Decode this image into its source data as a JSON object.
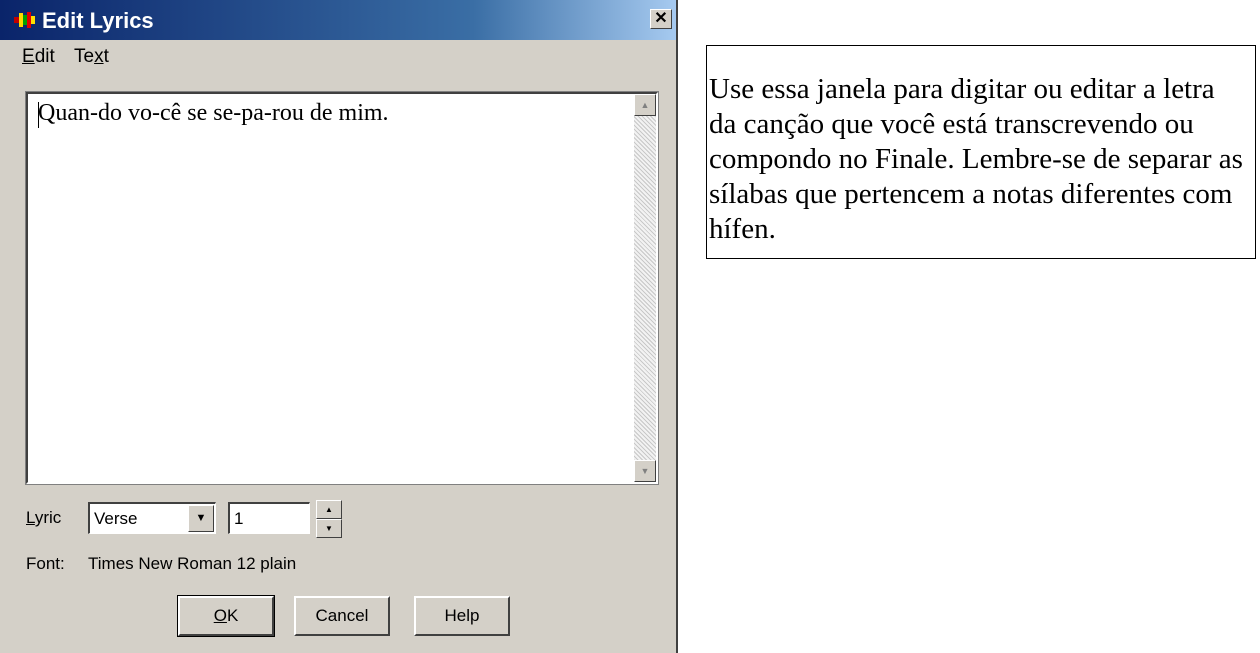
{
  "window": {
    "title": "Edit Lyrics",
    "close_glyph": "✕"
  },
  "menu": {
    "items": [
      {
        "label_pre": "",
        "accel": "E",
        "label_post": "dit"
      },
      {
        "label_pre": "Te",
        "accel": "x",
        "label_post": "t"
      }
    ]
  },
  "editor": {
    "content": "Quan-do vo-cê se se-pa-rou de mim."
  },
  "lyric": {
    "label_accel": "L",
    "label_rest": "yric",
    "type_value": "Verse",
    "number_value": "1"
  },
  "font": {
    "label": "Font:",
    "value": "Times New Roman 12 plain"
  },
  "buttons": {
    "ok_accel": "O",
    "ok_rest": "K",
    "cancel": "Cancel",
    "help": "Help"
  },
  "note": {
    "text": "Use essa janela para digitar ou editar a letra da canção que você está transcrevendo ou compondo no Finale. Lembre-se de separar as sílabas que pertencem a notas diferentes com hífen."
  },
  "colors": {
    "titlebar_start": "#0a246a",
    "titlebar_end": "#a6caf0",
    "dialog_face": "#d4d0c8"
  }
}
